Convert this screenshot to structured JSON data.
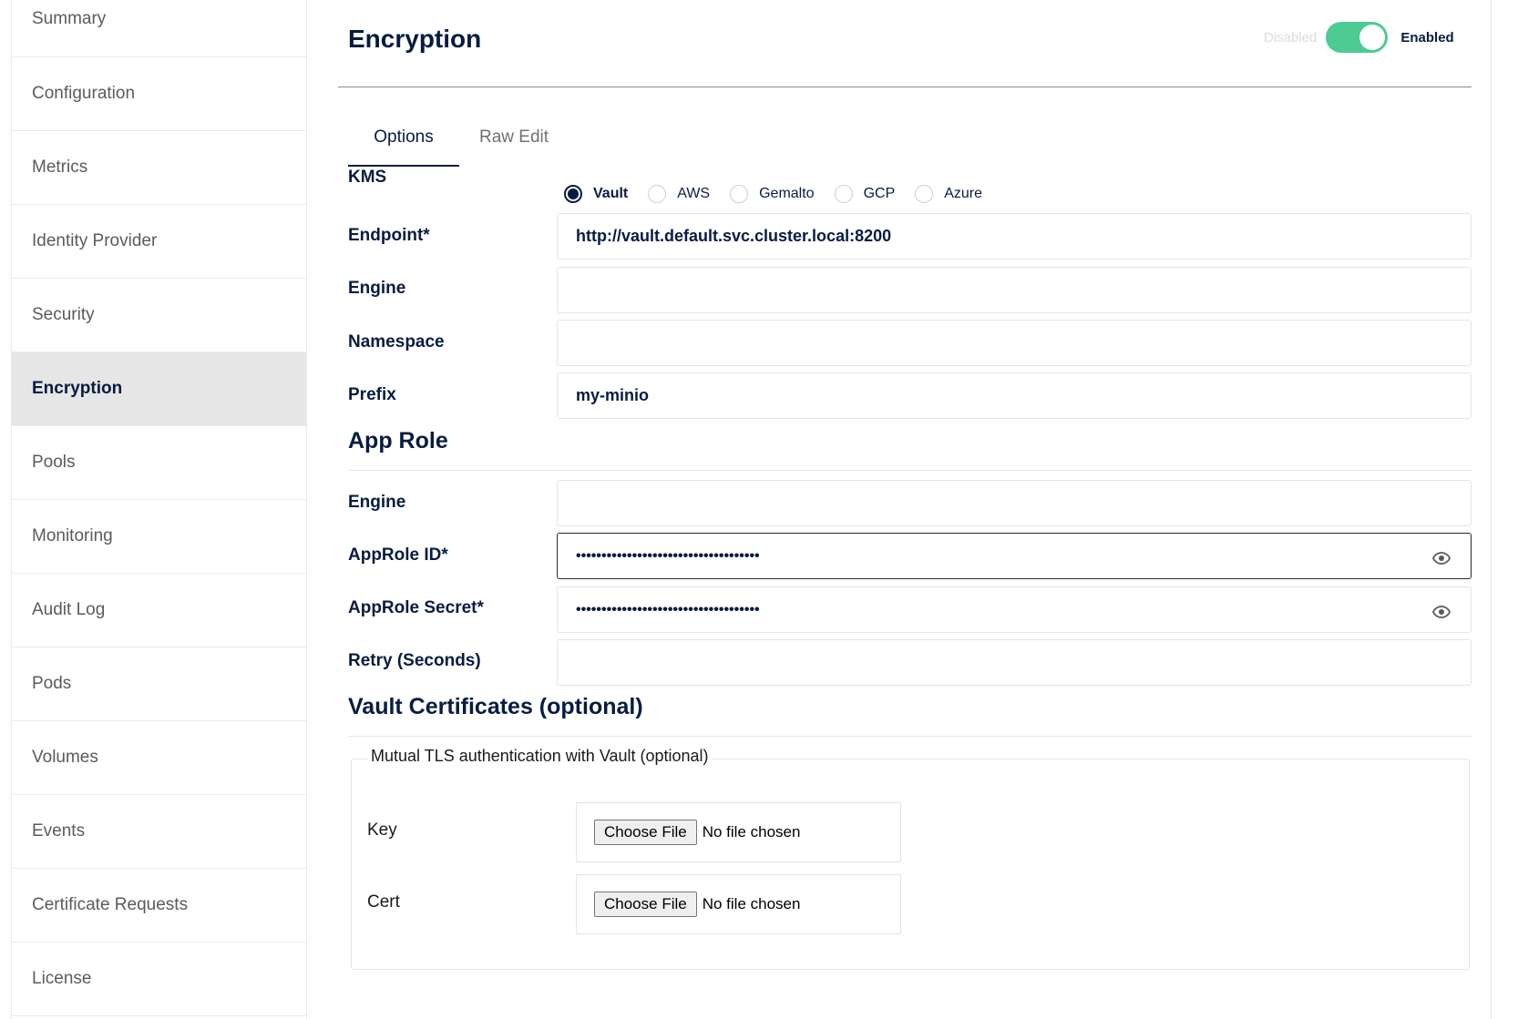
{
  "sidebar": {
    "items": [
      {
        "label": "Summary"
      },
      {
        "label": "Configuration"
      },
      {
        "label": "Metrics"
      },
      {
        "label": "Identity Provider"
      },
      {
        "label": "Security"
      },
      {
        "label": "Encryption",
        "active": true
      },
      {
        "label": "Pools"
      },
      {
        "label": "Monitoring"
      },
      {
        "label": "Audit Log"
      },
      {
        "label": "Pods"
      },
      {
        "label": "Volumes"
      },
      {
        "label": "Events"
      },
      {
        "label": "Certificate Requests"
      },
      {
        "label": "License"
      }
    ]
  },
  "header": {
    "title": "Encryption",
    "toggle": {
      "off_label": "Disabled",
      "on_label": "Enabled",
      "state": "enabled",
      "color": "#4ccb92"
    }
  },
  "tabs": [
    {
      "label": "Options",
      "active": true
    },
    {
      "label": "Raw Edit",
      "active": false
    }
  ],
  "kms": {
    "label": "KMS",
    "options": [
      "Vault",
      "AWS",
      "Gemalto",
      "GCP",
      "Azure"
    ],
    "selected": "Vault"
  },
  "fields": {
    "endpoint": {
      "label": "Endpoint*",
      "value": "http://vault.default.svc.cluster.local:8200"
    },
    "engine": {
      "label": "Engine",
      "value": ""
    },
    "namespace": {
      "label": "Namespace",
      "value": ""
    },
    "prefix": {
      "label": "Prefix",
      "value": "my-minio"
    }
  },
  "app_role": {
    "title": "App Role",
    "engine": {
      "label": "Engine",
      "value": ""
    },
    "approle_id": {
      "label": "AppRole ID*",
      "value": "••••••••••••••••••••••••••••••••••••",
      "icon": "eye-icon"
    },
    "approle_secret": {
      "label": "AppRole Secret*",
      "value": "••••••••••••••••••••••••••••••••••••",
      "icon": "eye-icon"
    },
    "retry": {
      "label": "Retry (Seconds)",
      "value": ""
    }
  },
  "vault_certs": {
    "title": "Vault Certificates (optional)",
    "mtls_legend": "Mutual TLS authentication with Vault (optional)",
    "key": {
      "label": "Key",
      "button": "Choose File",
      "status": "No file chosen"
    },
    "cert": {
      "label": "Cert",
      "button": "Choose File",
      "status": "No file chosen"
    }
  },
  "colors": {
    "text_primary": "#081c42",
    "active_sidebar_bg": "#e6e6e6",
    "toggle_on": "#4ccb92"
  }
}
